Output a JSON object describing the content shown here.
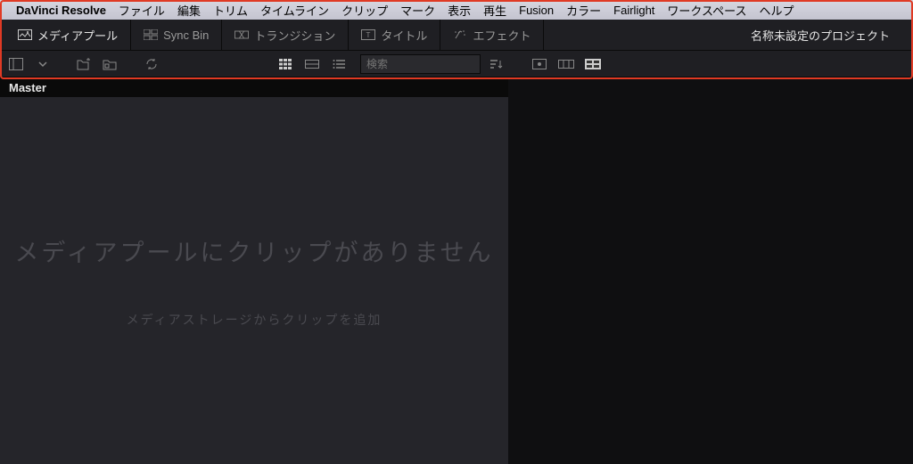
{
  "menubar": {
    "app_name": "DaVinci Resolve",
    "items": [
      "ファイル",
      "編集",
      "トリム",
      "タイムライン",
      "クリップ",
      "マーク",
      "表示",
      "再生",
      "Fusion",
      "カラー",
      "Fairlight",
      "ワークスペース",
      "ヘルプ"
    ]
  },
  "tabbar": {
    "tabs": [
      {
        "label": "メディアプール",
        "icon": "media-pool-icon",
        "active": true
      },
      {
        "label": "Sync Bin",
        "icon": "sync-bin-icon",
        "active": false
      },
      {
        "label": "トランジション",
        "icon": "transition-icon",
        "active": false
      },
      {
        "label": "タイトル",
        "icon": "title-icon",
        "active": false
      },
      {
        "label": "エフェクト",
        "icon": "effect-icon",
        "active": false
      }
    ],
    "project_name": "名称未設定のプロジェクト"
  },
  "toolbar2": {
    "search_placeholder": "検索"
  },
  "media_pool": {
    "master_label": "Master",
    "empty_main": "メディアプールにクリップがありません",
    "empty_sub": "メディアストレージからクリップを追加"
  }
}
